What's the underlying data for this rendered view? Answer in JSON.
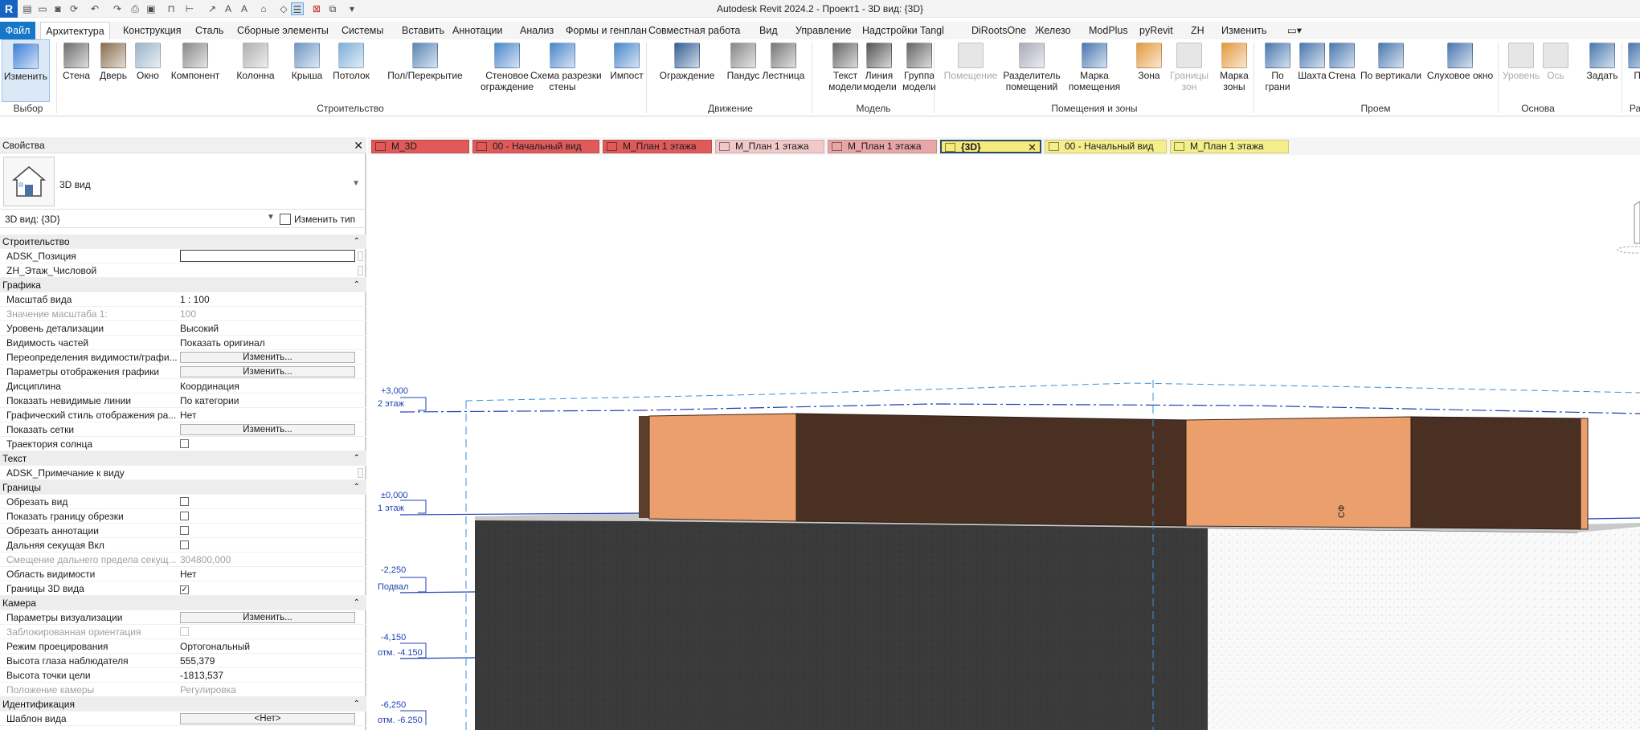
{
  "app": {
    "title": "Autodesk Revit 2024.2 - Проект1 - 3D вид: {3D}",
    "logo": "R"
  },
  "qat_icons": [
    "folder-open-icon",
    "save-icon",
    "sync-icon",
    "undo-icon",
    "redo-icon",
    "print-icon",
    "measure-icon",
    "dimension-icon",
    "text-icon",
    "home-3d-icon",
    "section-icon",
    "thin-lines-icon",
    "close-windows-icon",
    "switch-windows-icon",
    "customize-icon"
  ],
  "menu": {
    "file": "Файл",
    "tabs": [
      "Архитектура",
      "Конструкция",
      "Сталь",
      "Сборные элементы",
      "Системы",
      "Вставить",
      "Аннотации",
      "Анализ",
      "Формы и генплан",
      "Совместная работа",
      "Вид",
      "Управление",
      "Надстройки",
      "Tangl",
      "DiRootsOne",
      "Железо",
      "ModPlus",
      "pyRevit",
      "ZH",
      "Изменить"
    ],
    "active_tab": "Архитектура"
  },
  "ribbon": {
    "buttons": [
      {
        "name": "modify",
        "label": "Изменить",
        "state": "active"
      },
      {
        "name": "wall",
        "label": "Стена"
      },
      {
        "name": "door",
        "label": "Дверь"
      },
      {
        "name": "window",
        "label": "Окно"
      },
      {
        "name": "component",
        "label": "Компонент"
      },
      {
        "name": "column",
        "label": "Колонна"
      },
      {
        "name": "roof",
        "label": "Крыша"
      },
      {
        "name": "ceiling",
        "label": "Потолок"
      },
      {
        "name": "floor",
        "label": "Пол/Перекрытие"
      },
      {
        "name": "curtain-system",
        "label": "Стеновое\nограждение"
      },
      {
        "name": "curtain-grid",
        "label": "Схема разрезки\nстены"
      },
      {
        "name": "mullion",
        "label": "Импост"
      },
      {
        "name": "railing",
        "label": "Ограждение"
      },
      {
        "name": "ramp",
        "label": "Пандус"
      },
      {
        "name": "stair",
        "label": "Лестница"
      },
      {
        "name": "model-text",
        "label": "Текст\nмодели"
      },
      {
        "name": "model-line",
        "label": "Линия\nмодели"
      },
      {
        "name": "model-group",
        "label": "Группа\nмодели"
      },
      {
        "name": "room",
        "label": "Помещение",
        "state": "disabled"
      },
      {
        "name": "room-separator",
        "label": "Разделитель\nпомещений"
      },
      {
        "name": "room-tag",
        "label": "Марка\nпомещения"
      },
      {
        "name": "area",
        "label": "Зона"
      },
      {
        "name": "area-boundary",
        "label": "Границы\nзон",
        "state": "disabled"
      },
      {
        "name": "area-tag",
        "label": "Марка\nзоны"
      },
      {
        "name": "by-face",
        "label": "По\nграни"
      },
      {
        "name": "shaft",
        "label": "Шахта"
      },
      {
        "name": "opening-wall",
        "label": "Стена"
      },
      {
        "name": "vertical",
        "label": "По вертикали"
      },
      {
        "name": "dormer",
        "label": "Слуховое окно"
      },
      {
        "name": "level",
        "label": "Уровень",
        "state": "disabled"
      },
      {
        "name": "grid",
        "label": "Ось",
        "state": "disabled"
      },
      {
        "name": "set",
        "label": "Задать"
      },
      {
        "name": "show",
        "label": "По"
      }
    ],
    "groups": [
      "Выбор",
      "Строительство",
      "Движение",
      "Модель",
      "Помещения и зоны",
      "Проем",
      "Основа",
      "Ра"
    ]
  },
  "properties": {
    "title": "Свойства",
    "type_name": "3D вид",
    "view_selector": "3D вид: {3D}",
    "edit_type": "Изменить тип",
    "rows": [
      {
        "kind": "section",
        "label": "Строительство"
      },
      {
        "label": "ADSK_Позиция",
        "value": "",
        "control": "input"
      },
      {
        "label": "ZH_Этаж_Числовой",
        "value": "",
        "control": "scroll"
      },
      {
        "kind": "section",
        "label": "Графика"
      },
      {
        "label": "Масштаб вида",
        "value": "1 : 100"
      },
      {
        "label": "Значение масштаба    1:",
        "value": "100",
        "disabled": true
      },
      {
        "label": "Уровень детализации",
        "value": "Высокий"
      },
      {
        "label": "Видимость частей",
        "value": "Показать оригинал"
      },
      {
        "label": "Переопределения видимости/графи...",
        "value": "Изменить...",
        "control": "button"
      },
      {
        "label": "Параметры отображения графики",
        "value": "Изменить...",
        "control": "button"
      },
      {
        "label": "Дисциплина",
        "value": "Координация"
      },
      {
        "label": "Показать невидимые линии",
        "value": "По категории"
      },
      {
        "label": "Графический стиль отображения ра...",
        "value": "Нет"
      },
      {
        "label": "Показать сетки",
        "value": "Изменить...",
        "control": "button"
      },
      {
        "label": "Траектория солнца",
        "value": "",
        "control": "checkbox",
        "checked": false
      },
      {
        "kind": "section",
        "label": "Текст"
      },
      {
        "label": "ADSK_Примечание к виду",
        "value": "",
        "control": "scroll"
      },
      {
        "kind": "section",
        "label": "Границы"
      },
      {
        "label": "Обрезать вид",
        "value": "",
        "control": "checkbox",
        "checked": false
      },
      {
        "label": "Показать границу обрезки",
        "value": "",
        "control": "checkbox",
        "checked": false
      },
      {
        "label": "Обрезать аннотации",
        "value": "",
        "control": "checkbox",
        "checked": false
      },
      {
        "label": "Дальняя секущая Вкл",
        "value": "",
        "control": "checkbox",
        "checked": false
      },
      {
        "label": "Смещение дальнего предела секущ...",
        "value": "304800,000",
        "disabled": true
      },
      {
        "label": "Область видимости",
        "value": "Нет"
      },
      {
        "label": "Границы 3D вида",
        "value": "",
        "control": "checkbox",
        "checked": true
      },
      {
        "kind": "section",
        "label": "Камера"
      },
      {
        "label": "Параметры визуализации",
        "value": "Изменить...",
        "control": "button"
      },
      {
        "label": "Заблокированная ориентация",
        "value": "",
        "control": "checkbox",
        "checked": false,
        "disabled": true
      },
      {
        "label": "Режим проецирования",
        "value": "Ортогональный"
      },
      {
        "label": "Высота глаза наблюдателя",
        "value": "555,379"
      },
      {
        "label": "Высота точки цели",
        "value": "-1813,537"
      },
      {
        "label": "Положение камеры",
        "value": "Регулировка",
        "disabled": true
      },
      {
        "kind": "section",
        "label": "Идентификация"
      },
      {
        "label": "Шаблон вида",
        "value": "<Нет>",
        "control": "button"
      }
    ]
  },
  "view_tabs": [
    {
      "label": "M_3D",
      "color": "#e05a5a",
      "icon": "3d-view-icon"
    },
    {
      "label": "00 - Начальный вид",
      "color": "#e05a5a",
      "icon": "plan-view-icon"
    },
    {
      "label": "М_План 1 этажа",
      "color": "#e05a5a",
      "icon": "plan-view-icon"
    },
    {
      "label": "М_План 1 этажа",
      "color": "#f2c9c9",
      "icon": "plan-view-icon"
    },
    {
      "label": "М_План 1 этажа",
      "color": "#e8a6a6",
      "icon": "plan-view-icon"
    },
    {
      "label": "{3D}",
      "color": "#f5ea7a",
      "icon": "3d-view-icon",
      "active": true
    },
    {
      "label": "00 - Начальный вид",
      "color": "#f5ee8c",
      "icon": "plan-view-icon"
    },
    {
      "label": "М_План 1 этажа",
      "color": "#f5ee8c",
      "icon": "plan-view-icon"
    }
  ],
  "levels": [
    {
      "elevation": "+3,000",
      "name": "2 этаж"
    },
    {
      "elevation": "±0,000",
      "name": "1 этаж"
    },
    {
      "elevation": "-2,250",
      "name": "Подвал"
    },
    {
      "elevation": "-4,150",
      "name": "отм. -4.150"
    },
    {
      "elevation": "-6,250",
      "name": "отм. -6.250"
    }
  ],
  "model_tag": "СФ",
  "colors": {
    "brand": "#1565c0",
    "file_tab": "#1677c9",
    "wall_orange": "#eb9f6c",
    "wall_dark": "#4a3022",
    "soil_dark": "#3b3b3b",
    "level_line": "#1f3fb5",
    "grid_line": "#3a8fd6"
  }
}
